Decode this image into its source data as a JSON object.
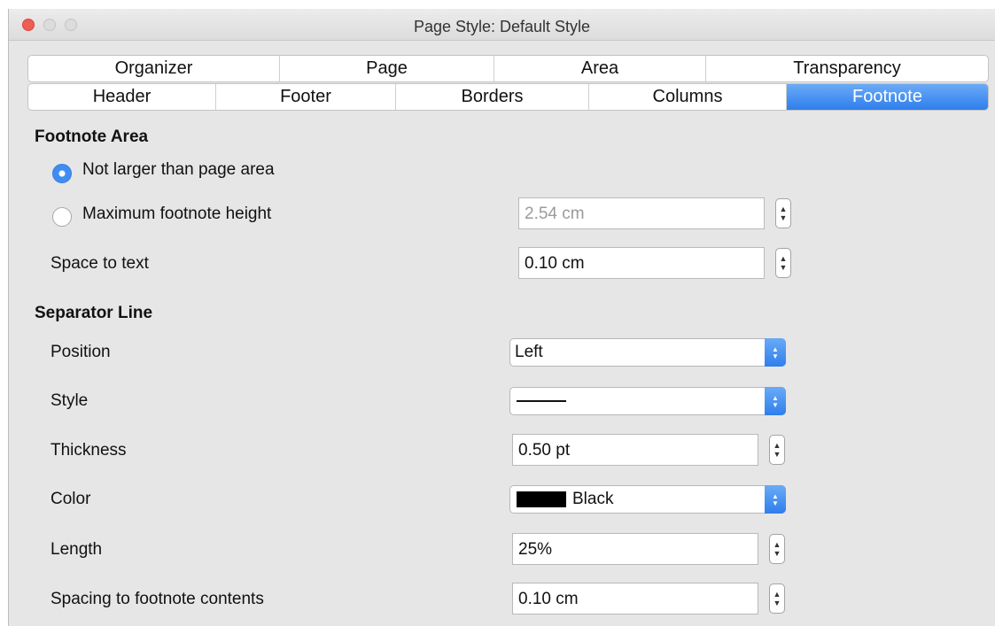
{
  "window": {
    "title": "Page Style: Default Style"
  },
  "tabs": {
    "row1": [
      "Organizer",
      "Page",
      "Area",
      "Transparency"
    ],
    "row2": [
      "Header",
      "Footer",
      "Borders",
      "Columns",
      "Footnote"
    ],
    "active": "Footnote"
  },
  "footnote_area": {
    "heading": "Footnote Area",
    "option_not_larger": "Not larger than page area",
    "option_max_height": "Maximum footnote height",
    "selected": "Not larger than page area",
    "max_height_value": "2.54 cm",
    "space_label": "Space to text",
    "space_value": "0.10 cm"
  },
  "separator": {
    "heading": "Separator Line",
    "position_label": "Position",
    "position_value": "Left",
    "style_label": "Style",
    "thickness_label": "Thickness",
    "thickness_value": "0.50 pt",
    "color_label": "Color",
    "color_value": "Black",
    "color_hex": "#000000",
    "length_label": "Length",
    "length_value": "25%",
    "spacing_label": "Spacing to footnote contents",
    "spacing_value": "0.10 cm"
  },
  "colors": {
    "accent": "#3f8cf3",
    "close_button": "#ee5e55"
  }
}
